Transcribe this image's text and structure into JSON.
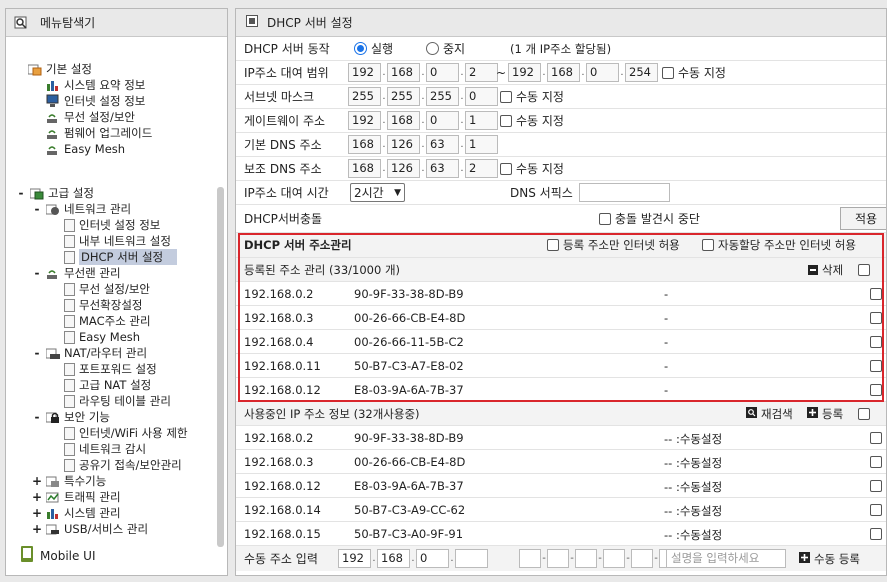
{
  "menu": {
    "title": "메뉴탐색기",
    "basic": {
      "label": "기본 설정",
      "items": [
        "시스템 요약 정보",
        "인터넷 설정 정보",
        "무선 설정/보안",
        "펌웨어 업그레이드",
        "Easy Mesh"
      ]
    },
    "advanced": {
      "label": "고급 설정",
      "network": {
        "label": "네트워크 관리",
        "items": [
          "인터넷 설정 정보",
          "내부 네트워크 설정",
          "DHCP 서버 설정"
        ]
      },
      "wireless": {
        "label": "무선랜 관리",
        "items": [
          "무선 설정/보안",
          "무선확장설정",
          "MAC주소 관리",
          "Easy Mesh"
        ]
      },
      "nat": {
        "label": "NAT/라우터 관리",
        "items": [
          "포트포워드 설정",
          "고급 NAT 설정",
          "라우팅 테이블 관리"
        ]
      },
      "security": {
        "label": "보안 기능",
        "items": [
          "인터넷/WiFi 사용 제한",
          "네트워크 감시",
          "공유기 접속/보안관리"
        ]
      },
      "others": [
        "특수기능",
        "트래픽 관리",
        "시스템 관리",
        "USB/서비스 관리"
      ]
    },
    "mobile": "Mobile UI"
  },
  "dhcp": {
    "title": "DHCP 서버 설정",
    "operation": {
      "label": "DHCP 서버 동작",
      "run": "실행",
      "stop": "중지",
      "note": "(1 개 IP주소 할당됨)"
    },
    "range": {
      "label": "IP주소 대여 범위",
      "start": [
        "192",
        "168",
        "0",
        "2"
      ],
      "tilde": "~",
      "end": [
        "192",
        "168",
        "0",
        "254"
      ],
      "manual": "수동 지정"
    },
    "subnet": {
      "label": "서브넷 마스크",
      "value": [
        "255",
        "255",
        "255",
        "0"
      ],
      "manual": "수동 지정"
    },
    "gateway": {
      "label": "게이트웨이 주소",
      "value": [
        "192",
        "168",
        "0",
        "1"
      ],
      "manual": "수동 지정"
    },
    "dns1": {
      "label": "기본 DNS 주소",
      "value": [
        "168",
        "126",
        "63",
        "1"
      ]
    },
    "dns2": {
      "label": "보조 DNS 주소",
      "value": [
        "168",
        "126",
        "63",
        "2"
      ],
      "manual": "수동 지정"
    },
    "lease": {
      "label": "IP주소 대여 시간",
      "value": "2시간",
      "dns_suffix": "DNS 서픽스"
    },
    "conflict": {
      "label": "DHCP서버충돌",
      "stop": "충돌 발견시 중단",
      "apply": "적용"
    }
  },
  "address_mgmt": {
    "title": "DHCP 서버 주소관리",
    "opt1": "등록 주소만 인터넷 허용",
    "opt2": "자동할당 주소만 인터넷 허용",
    "registered_title": "등록된 주소 관리 (33/1000 개)",
    "delete": "삭제",
    "registered": [
      {
        "ip": "192.168.0.2",
        "mac": "90-9F-33-38-8D-B9",
        "desc": "-"
      },
      {
        "ip": "192.168.0.3",
        "mac": "00-26-66-CB-E4-8D",
        "desc": "-"
      },
      {
        "ip": "192.168.0.4",
        "mac": "00-26-66-11-5B-C2",
        "desc": "-"
      },
      {
        "ip": "192.168.0.11",
        "mac": "50-B7-C3-A7-E8-02",
        "desc": "-"
      },
      {
        "ip": "192.168.0.12",
        "mac": "E8-03-9A-6A-7B-37",
        "desc": "-"
      }
    ]
  },
  "in_use": {
    "title": "사용중인 IP 주소 정보 (32개사용중)",
    "rescan": "재검색",
    "register": "등록",
    "rows": [
      {
        "ip": "192.168.0.2",
        "mac": "90-9F-33-38-8D-B9",
        "desc": "-- :수동설정"
      },
      {
        "ip": "192.168.0.3",
        "mac": "00-26-66-CB-E4-8D",
        "desc": "-- :수동설정"
      },
      {
        "ip": "192.168.0.12",
        "mac": "E8-03-9A-6A-7B-37",
        "desc": "-- :수동설정"
      },
      {
        "ip": "192.168.0.14",
        "mac": "50-B7-C3-A9-CC-62",
        "desc": "-- :수동설정"
      },
      {
        "ip": "192.168.0.15",
        "mac": "50-B7-C3-A0-9F-91",
        "desc": "-- :수동설정"
      }
    ]
  },
  "manual_input": {
    "label": "수동 주소 입력",
    "ip": [
      "192",
      "168",
      "0",
      ""
    ],
    "placeholder": "설명을 입력하세요",
    "register": "수동 등록"
  }
}
